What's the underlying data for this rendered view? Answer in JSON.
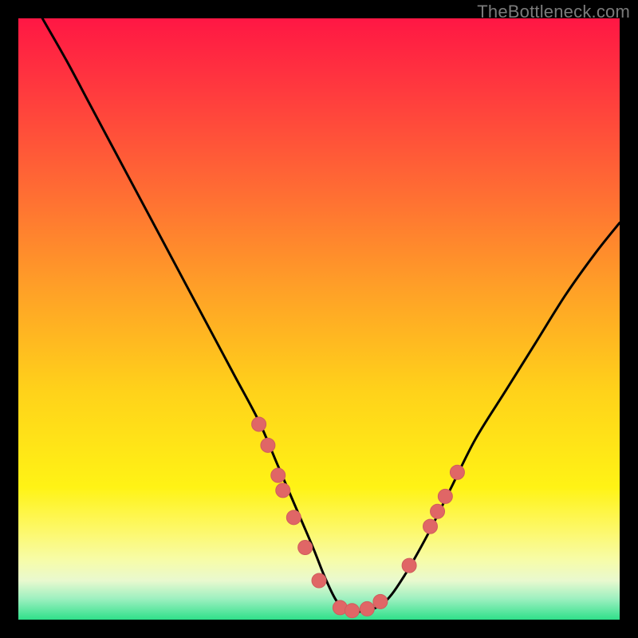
{
  "watermark": "TheBottleneck.com",
  "colors": {
    "bg": "#000000",
    "curve": "#000000",
    "marker": "#e06666",
    "marker_stroke": "#cf5d5d"
  },
  "chart_data": {
    "type": "line",
    "title": "",
    "xlabel": "",
    "ylabel": "",
    "xlim": [
      0,
      100
    ],
    "ylim": [
      0,
      100
    ],
    "gradient_stops": [
      {
        "offset": 0.0,
        "color": "#ff1744"
      },
      {
        "offset": 0.12,
        "color": "#ff3a3e"
      },
      {
        "offset": 0.28,
        "color": "#ff6a34"
      },
      {
        "offset": 0.45,
        "color": "#ffa027"
      },
      {
        "offset": 0.62,
        "color": "#ffd21a"
      },
      {
        "offset": 0.78,
        "color": "#fff315"
      },
      {
        "offset": 0.85,
        "color": "#fdf868"
      },
      {
        "offset": 0.9,
        "color": "#f7fca7"
      },
      {
        "offset": 0.935,
        "color": "#e9f9cf"
      },
      {
        "offset": 0.965,
        "color": "#9ef0c0"
      },
      {
        "offset": 1.0,
        "color": "#2fe08a"
      }
    ],
    "series": [
      {
        "name": "bottleneck-curve",
        "x": [
          4,
          8,
          12,
          16,
          20,
          24,
          28,
          32,
          36,
          40,
          43,
          46,
          49,
          51,
          53,
          55,
          58,
          61,
          64,
          68,
          72,
          76,
          81,
          86,
          91,
          96,
          100
        ],
        "y": [
          100,
          93,
          85.5,
          78,
          70.5,
          63,
          55.5,
          48,
          40.5,
          33,
          26,
          19,
          12,
          7,
          3,
          1.5,
          1.5,
          3,
          7,
          14,
          22,
          30,
          38,
          46,
          54,
          61,
          66
        ]
      }
    ],
    "markers": {
      "name": "highlight-dots",
      "points": [
        {
          "x": 40.0,
          "y": 32.5
        },
        {
          "x": 41.5,
          "y": 29.0
        },
        {
          "x": 43.2,
          "y": 24.0
        },
        {
          "x": 44.0,
          "y": 21.5
        },
        {
          "x": 45.8,
          "y": 17.0
        },
        {
          "x": 47.7,
          "y": 12.0
        },
        {
          "x": 50.0,
          "y": 6.5
        },
        {
          "x": 53.5,
          "y": 2.0
        },
        {
          "x": 55.5,
          "y": 1.5
        },
        {
          "x": 58.0,
          "y": 1.8
        },
        {
          "x": 60.2,
          "y": 3.0
        },
        {
          "x": 65.0,
          "y": 9.0
        },
        {
          "x": 68.5,
          "y": 15.5
        },
        {
          "x": 69.7,
          "y": 18.0
        },
        {
          "x": 71.0,
          "y": 20.5
        },
        {
          "x": 73.0,
          "y": 24.5
        }
      ]
    }
  }
}
